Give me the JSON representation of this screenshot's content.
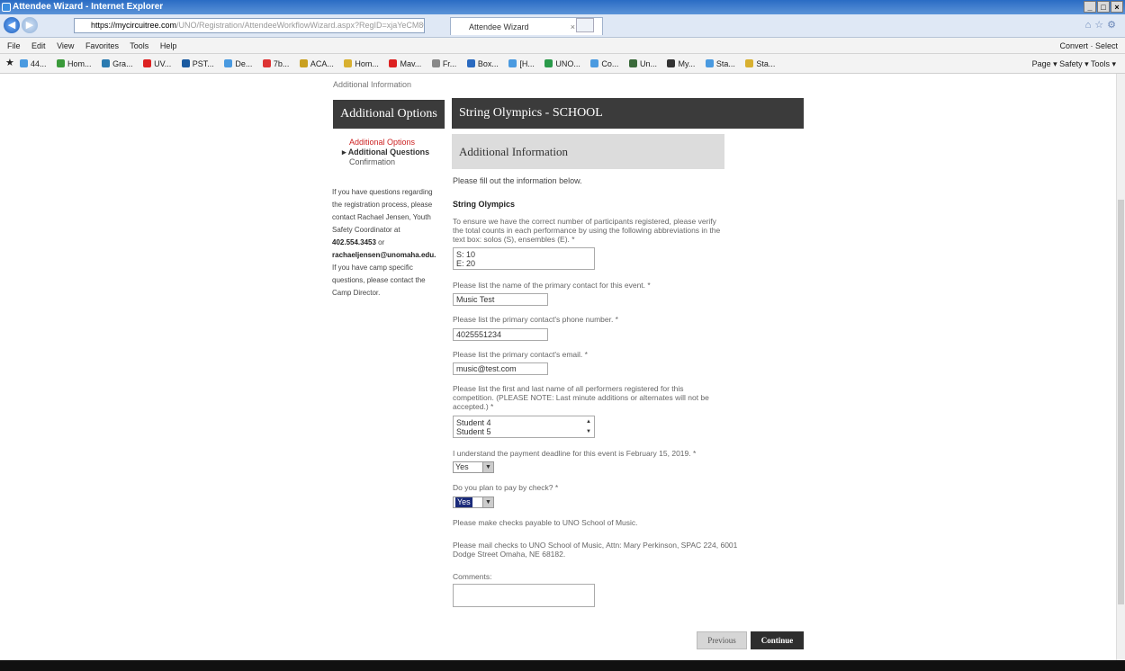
{
  "browser": {
    "window_title": "Attendee Wizard - Internet Explorer",
    "url_host": "https://mycircuitree.com",
    "url_rest": "/UNO/Registration/AttendeeWorkflowWizard.aspx?RegID=xjaYeCM80J",
    "tab_label": "Attendee Wizard",
    "menu": [
      "File",
      "Edit",
      "View",
      "Favorites",
      "Tools",
      "Help"
    ],
    "menu_right": "Convert  ·  Select",
    "favorites": [
      "44...",
      "Hom...",
      "Gra...",
      "UV...",
      "PST...",
      "De...",
      "7b...",
      "ACA...",
      "Hom...",
      "Mav...",
      "Fr...",
      "Box...",
      "[H...",
      "UNO...",
      "Co...",
      "Un...",
      "My...",
      "Sta...",
      "Sta..."
    ],
    "favorites_right": "Page ▾  Safety ▾  Tools ▾"
  },
  "breadcrumb": "Additional Information",
  "sidebar": {
    "heading": "Additional Options",
    "steps": [
      "Additional Options",
      "Additional Questions",
      "Confirmation"
    ],
    "help_text_1": "If you have questions regarding the registration process, please contact Rachael Jensen, Youth Safety Coordinator at",
    "phone": "402.554.3453",
    "or": "or",
    "email": "rachaeljensen@unomaha.edu.",
    "help_text_2": "If you have camp specific questions, please contact the Camp Director."
  },
  "main": {
    "heading": "String Olympics - SCHOOL",
    "section_title": "Additional Information",
    "intro": "Please fill out the information below.",
    "group_name": "String Olympics",
    "q1": "To ensure we have the correct number of participants registered, please verify the total counts in each performance by using the following abbreviations in the text box: solos (S), ensembles (E). *",
    "a1_line1": "S: 10",
    "a1_line2": "E: 20",
    "q2": "Please list the name of the primary contact for this event. *",
    "a2": "Music Test",
    "q3": "Please list the primary contact's phone number. *",
    "a3": "4025551234",
    "q4": "Please list the primary contact's email. *",
    "a4": "music@test.com",
    "q5": "Please list the first and last name of all performers registered for this competition. (PLEASE NOTE: Last minute additions or alternates will not be accepted.) *",
    "a5_line1": "Student 4",
    "a5_line2": "Student 5",
    "q6": "I understand the payment deadline for this event is February 15, 2019. *",
    "a6": "Yes",
    "q7": "Do you plan to pay by check? *",
    "a7": "Yes",
    "note1": "Please make checks payable to UNO School of Music.",
    "note2": "Please mail checks to UNO School of Music, Attn: Mary Perkinson, SPAC 224, 6001 Dodge Street Omaha, NE 68182.",
    "comments_label": "Comments:",
    "comments_value": "",
    "previous_label": "Previous",
    "continue_label": "Continue"
  }
}
